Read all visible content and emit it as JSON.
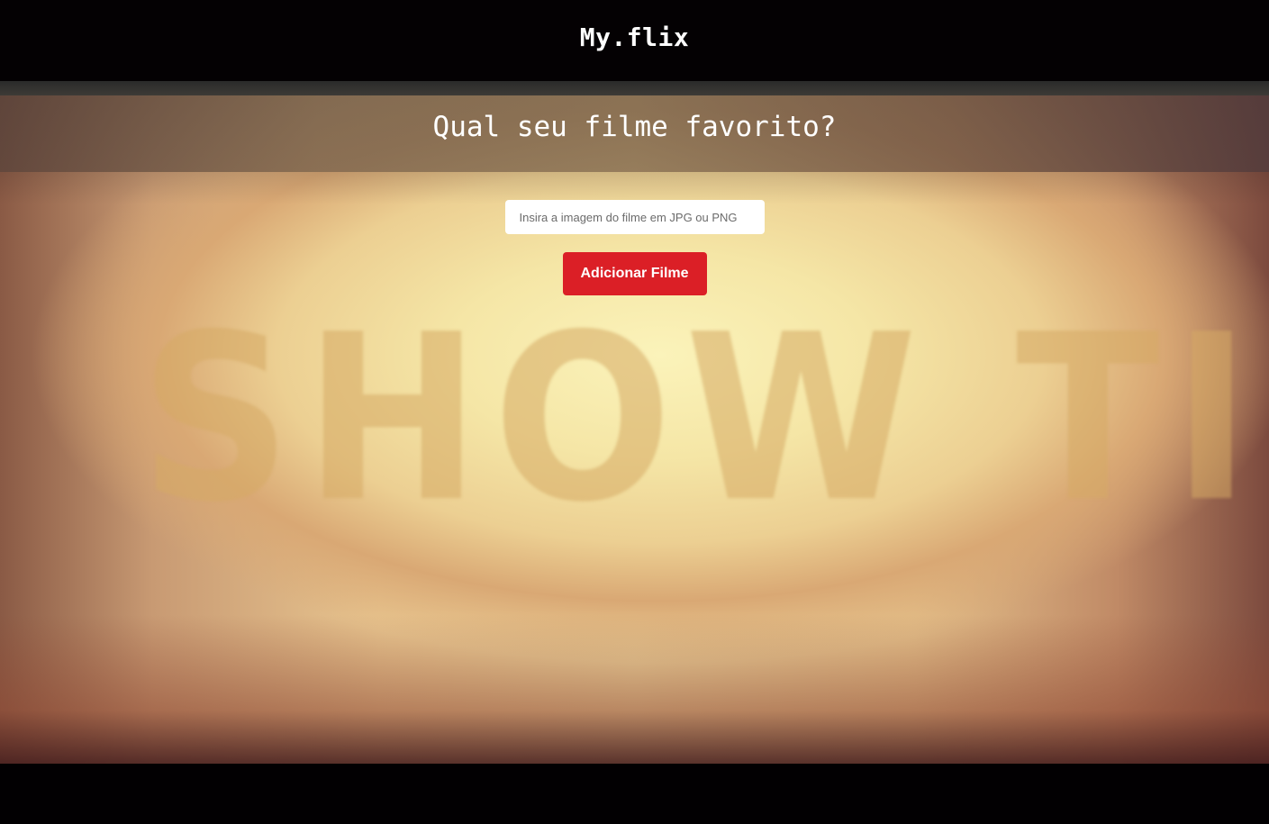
{
  "header": {
    "brand": "My.flix"
  },
  "hero": {
    "background_text": "SHOW TIME"
  },
  "main": {
    "title": "Qual seu filme favorito?",
    "image_input": {
      "value": "",
      "placeholder": "Insira a imagem do filme em JPG ou PNG"
    },
    "add_button_label": "Adicionar Filme"
  },
  "colors": {
    "background": "#020002",
    "button": "#db1f26",
    "text": "#ffffff"
  }
}
